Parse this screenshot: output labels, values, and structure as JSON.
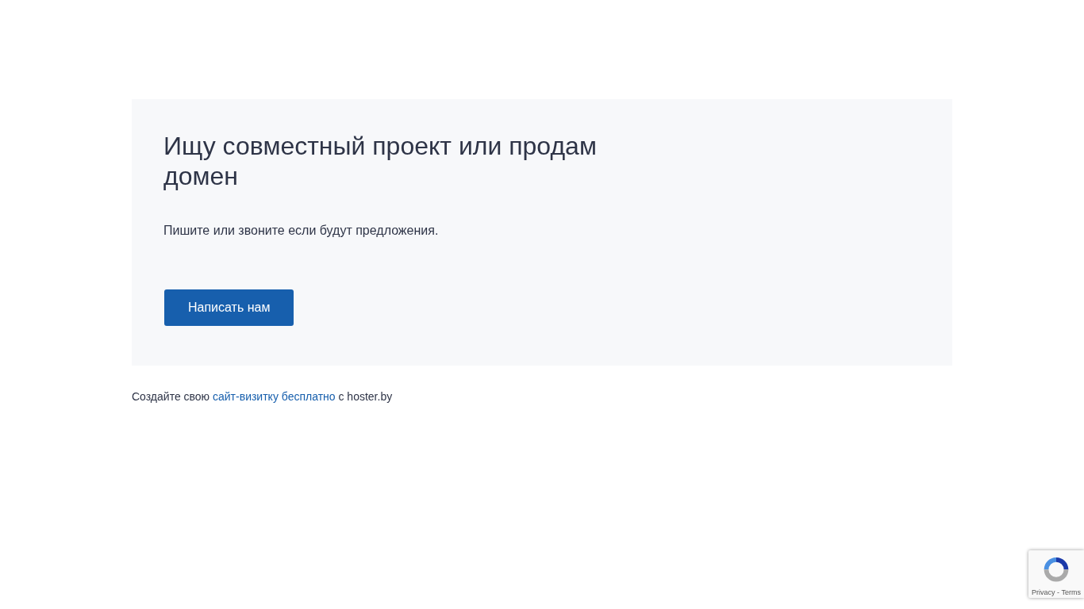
{
  "hero": {
    "title": "Ищу совместный проект или продам домен",
    "text": "Пишите или звоните если будут предложения.",
    "button": "Написать нам"
  },
  "footer": {
    "before": "Создайте свою",
    "link": "сайт-визитку бесплатно",
    "after": "с hoster.by"
  },
  "recaptcha": {
    "links": "Privacy - Terms"
  }
}
